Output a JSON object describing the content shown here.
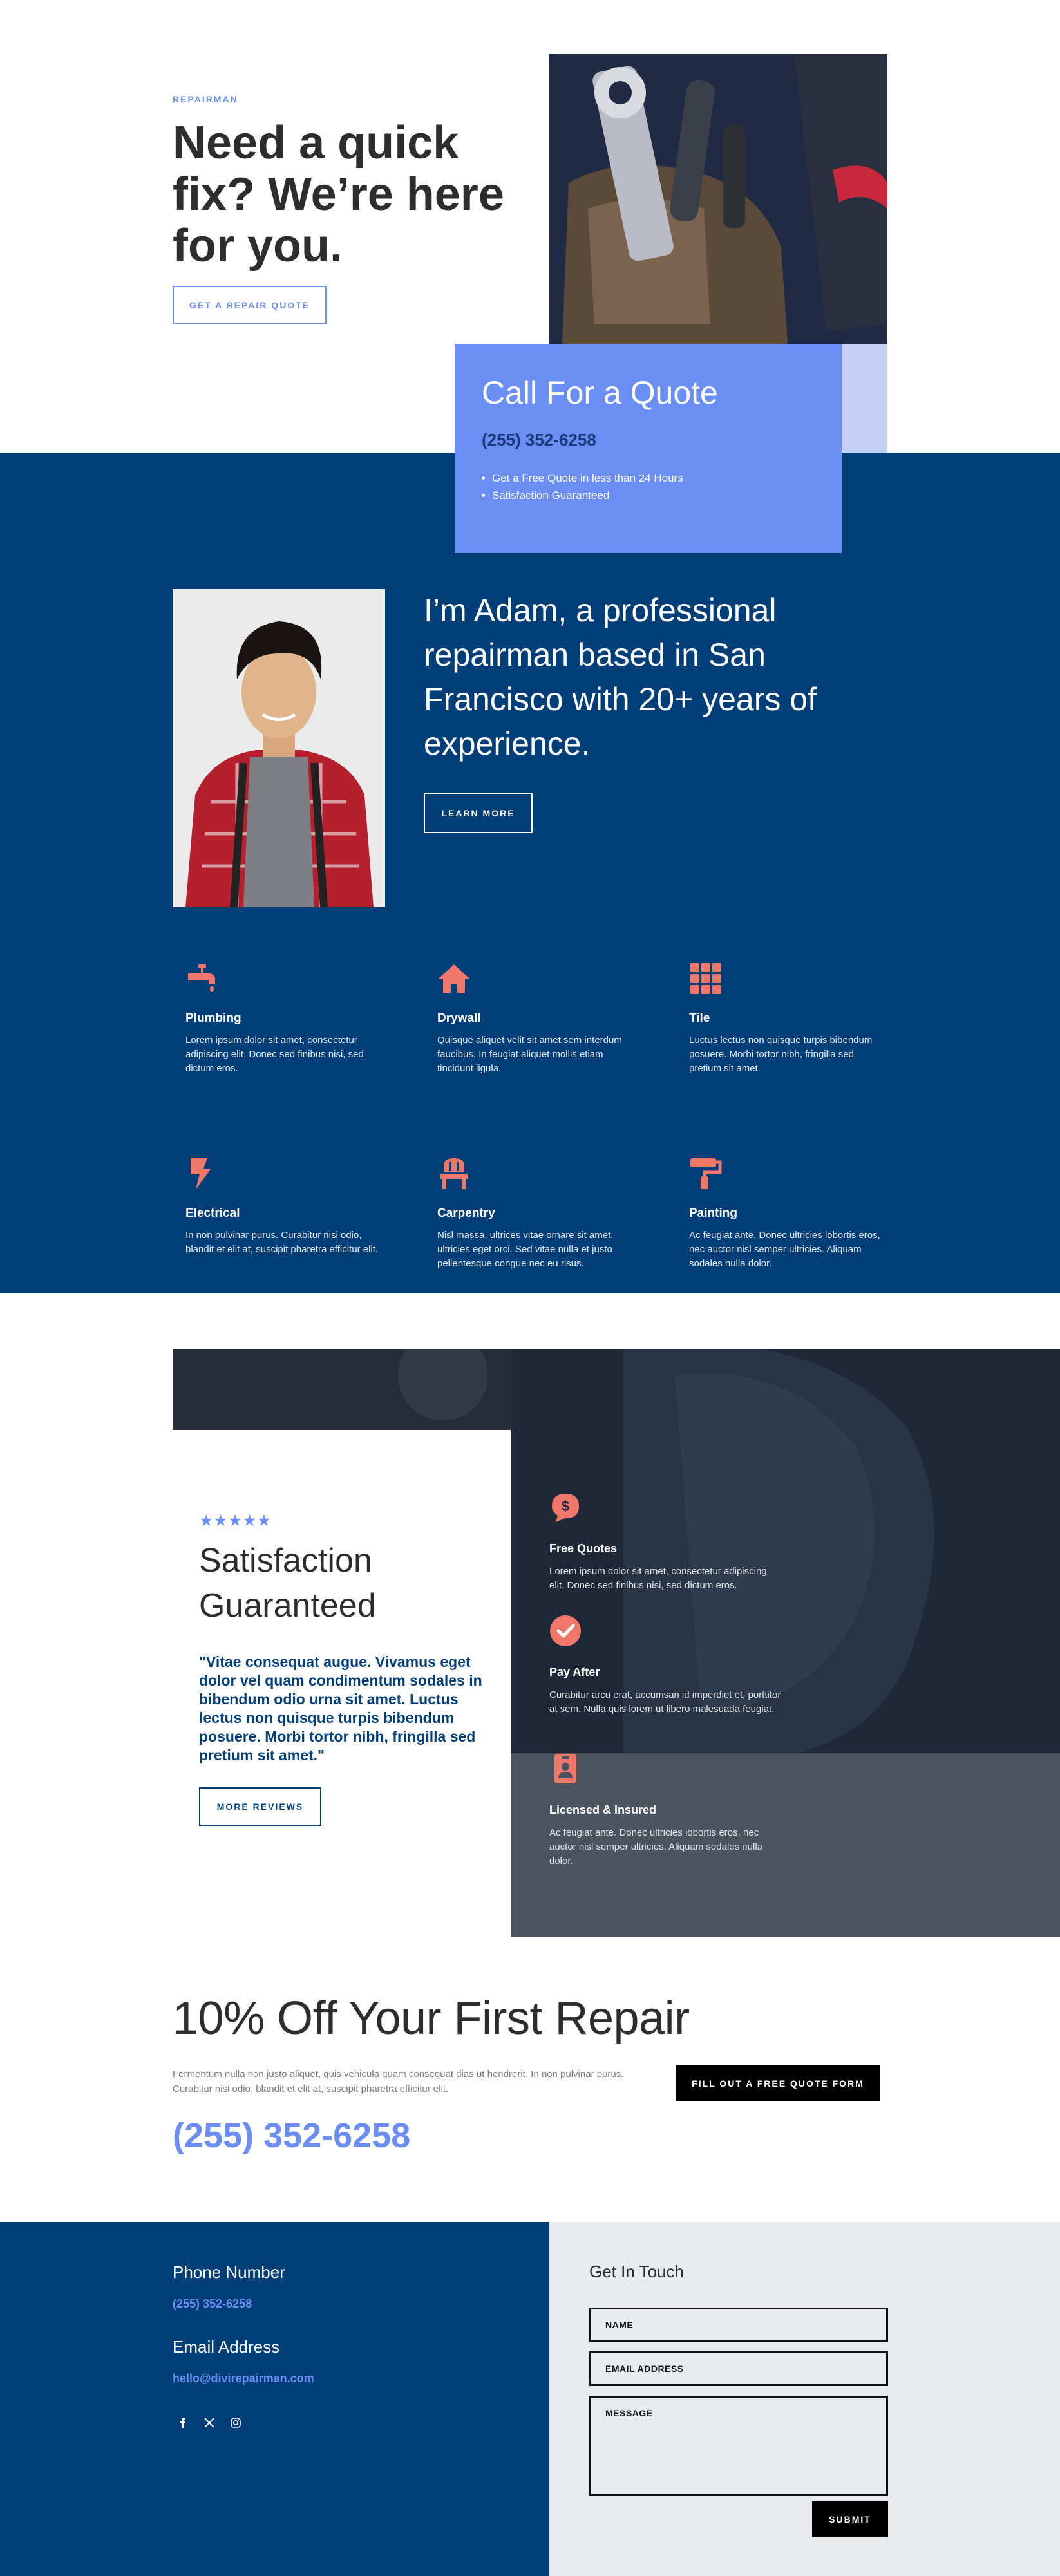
{
  "hero": {
    "eyebrow": "REPAIRMAN",
    "title": "Need a quick fix? We’re here for you.",
    "cta": "GET A REPAIR QUOTE"
  },
  "quote_card": {
    "title": "Call For a Quote",
    "phone": "(255) 352-6258",
    "bullets": [
      "Get a Free Quote in less than 24 Hours",
      "Satisfaction Guaranteed"
    ]
  },
  "about": {
    "text": "I’m Adam, a professional repairman based in San Francisco with 20+ years of experience.",
    "cta": "LEARN MORE"
  },
  "services": [
    {
      "icon": "faucet-icon",
      "title": "Plumbing",
      "text": "Lorem ipsum dolor sit amet, consectetur adipiscing elit. Donec sed finibus nisi, sed dictum eros."
    },
    {
      "icon": "house-icon",
      "title": "Drywall",
      "text": "Quisque aliquet velit sit amet sem interdum faucibus. In feugiat aliquet mollis etiam tincidunt ligula."
    },
    {
      "icon": "tile-grid-icon",
      "title": "Tile",
      "text": "Luctus lectus non quisque turpis bibendum posuere. Morbi tortor nibh, fringilla sed pretium sit amet."
    },
    {
      "icon": "lightning-icon",
      "title": "Electrical",
      "text": "In non pulvinar purus. Curabitur nisi odio, blandit et elit at, suscipit pharetra efficitur elit."
    },
    {
      "icon": "chair-icon",
      "title": "Carpentry",
      "text": "Nisl massa, ultrices vitae ornare sit amet, ultricies eget orci. Sed vitae nulla et justo pellentesque congue nec eu risus."
    },
    {
      "icon": "paint-roller-icon",
      "title": "Painting",
      "text": "Ac feugiat ante. Donec ultricies lobortis eros, nec auctor nisl semper ultricies. Aliquam sodales nulla dolor."
    }
  ],
  "satisfaction": {
    "stars": "★★★★★",
    "title": "Satisfaction Guaranteed",
    "quote": "\"Vitae consequat augue. Vivamus eget dolor vel quam condimentum sodales in bibendum odio urna sit amet. Luctus lectus non quisque turpis bibendum posuere. Morbi tortor nibh, fringilla sed pretium sit amet.\"",
    "cta": "MORE REVIEWS"
  },
  "features": [
    {
      "icon": "dollar-chat-icon",
      "title": "Free Quotes",
      "text": "Lorem ipsum dolor sit amet, consectetur adipiscing elit. Donec sed finibus nisi, sed dictum eros."
    },
    {
      "icon": "checkmark-icon",
      "title": "Pay After",
      "text": "Curabitur arcu erat, accumsan id imperdiet et, porttitor at sem. Nulla quis lorem ut libero malesuada feugiat."
    },
    {
      "icon": "id-badge-icon",
      "title": "Licensed & Insured",
      "text": "Ac feugiat ante. Donec ultricies lobortis eros, nec auctor nisl semper ultricies. Aliquam sodales nulla dolor."
    }
  ],
  "discount": {
    "title": "10% Off Your First Repair",
    "text": "Fermentum nulla non justo aliquet, quis vehicula quam consequat dias ut hendrerit. In non pulvinar purus. Curabitur nisi odio, blandit et elit at, suscipit pharetra efficitur elit.",
    "cta": "FILL OUT A FREE QUOTE FORM",
    "phone": "(255) 352-6258"
  },
  "footer": {
    "phone_heading": "Phone Number",
    "phone": "(255) 352-6258",
    "email_heading": "Email Address",
    "email": "hello@divirepairman.com",
    "social": [
      "facebook-icon",
      "x-icon",
      "instagram-icon"
    ],
    "contact_heading": "Get In Touch",
    "name_placeholder": "NAME",
    "email_placeholder": "EMAIL ADDRESS",
    "message_placeholder": "MESSAGE",
    "submit": "SUBMIT"
  },
  "colors": {
    "accent_blue": "#6b8ef5",
    "navy": "#023e78",
    "coral": "#f0786a"
  }
}
